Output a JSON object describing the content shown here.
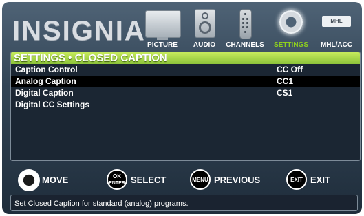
{
  "header": {
    "brand": "INSIGNIA",
    "nav": [
      {
        "label": "PICTURE",
        "icon": "tv-icon"
      },
      {
        "label": "AUDIO",
        "icon": "speaker-icon"
      },
      {
        "label": "CHANNELS",
        "icon": "remote-icon"
      },
      {
        "label": "SETTINGS",
        "icon": "gear-icon",
        "active": true
      },
      {
        "label": "MHL/ACC",
        "icon": "mhl-icon",
        "icon_text": "MHL"
      }
    ]
  },
  "panel": {
    "title": "SETTINGS • CLOSED CAPTION",
    "rows": [
      {
        "label": "Caption Control",
        "value": "CC Off"
      },
      {
        "label": "Analog Caption",
        "value": "CC1",
        "selected": true
      },
      {
        "label": "Digital Caption",
        "value": "CS1"
      },
      {
        "label": "Digital CC Settings",
        "value": ""
      }
    ]
  },
  "controls": [
    {
      "button": "",
      "label": "MOVE",
      "icon": "dpad-icon"
    },
    {
      "button": "OK",
      "button_sub": "ENTER",
      "label": "SELECT",
      "icon": "ok-enter-button-icon"
    },
    {
      "button": "MENU",
      "label": "PREVIOUS",
      "icon": "menu-button-icon"
    },
    {
      "button": "EXIT",
      "label": "EXIT",
      "icon": "exit-button-icon"
    }
  ],
  "help_text": "Set Closed Caption for standard (analog) programs.",
  "colors": {
    "accent_green": "#8cc33a",
    "selected_row": "#000000",
    "background": "#324455"
  }
}
